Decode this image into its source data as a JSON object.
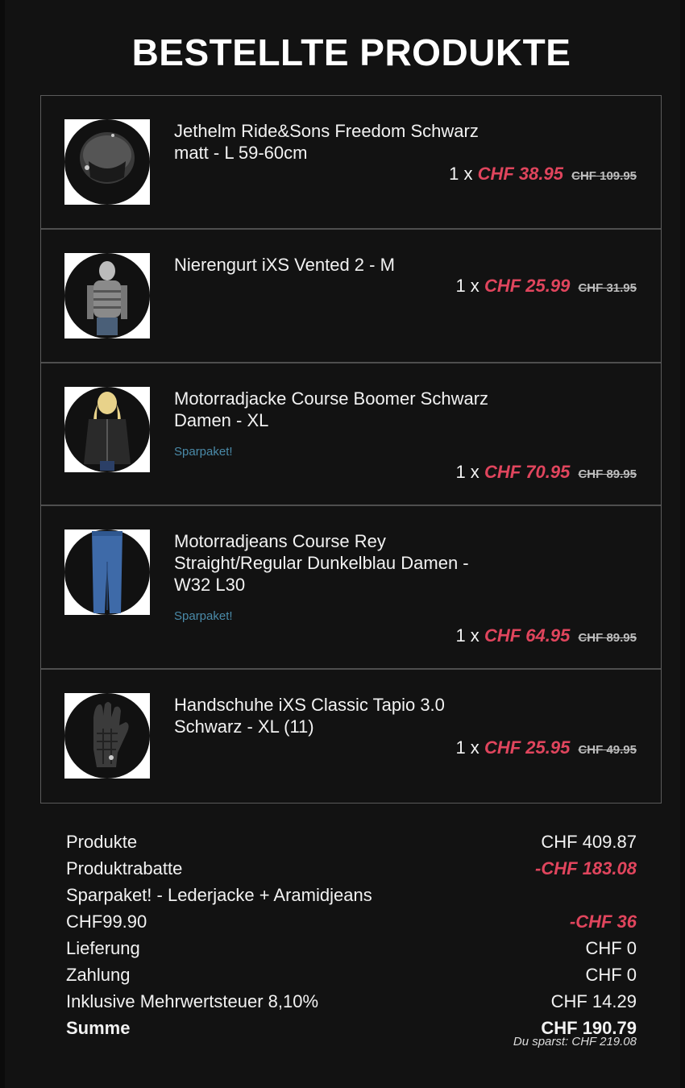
{
  "title": "BESTELLTE PRODUKTE",
  "products": [
    {
      "name": "Jethelm Ride&Sons Freedom Schwarz matt - L 59-60cm",
      "icon": "helmet-icon",
      "qty": "1 x",
      "price": "CHF 38.95",
      "old_price": "CHF 109.95",
      "badge": ""
    },
    {
      "name": "Nierengurt iXS Vented 2 - M",
      "icon": "kidney-belt-icon",
      "qty": "1 x",
      "price": "CHF 25.99",
      "old_price": "CHF 31.95",
      "badge": ""
    },
    {
      "name": "Motorradjacke Course Boomer Schwarz Damen - XL",
      "icon": "leather-jacket-icon",
      "qty": "1 x",
      "price": "CHF 70.95",
      "old_price": "CHF 89.95",
      "badge": "Sparpaket!"
    },
    {
      "name": "Motorradjeans Course Rey Straight/Regular Dunkelblau Damen - W32 L30",
      "icon": "jeans-icon",
      "qty": "1 x",
      "price": "CHF 64.95",
      "old_price": "CHF 89.95",
      "badge": "Sparpaket!"
    },
    {
      "name": "Handschuhe iXS Classic Tapio 3.0 Schwarz - XL (11)",
      "icon": "glove-icon",
      "qty": "1 x",
      "price": "CHF 25.95",
      "old_price": "CHF 49.95",
      "badge": ""
    }
  ],
  "summary": {
    "products_label": "Produkte",
    "products_value": "CHF 409.87",
    "discount_label": "Produktrabatte",
    "discount_value": "-CHF 183.08",
    "bundle_label": "Sparpaket! - Lederjacke + Aramidjeans CHF99.90",
    "bundle_value": "-CHF 36",
    "shipping_label": "Lieferung",
    "shipping_value": "CHF 0",
    "payment_label": "Zahlung",
    "payment_value": "CHF 0",
    "vat_label": "Inklusive Mehrwertsteuer 8,10%",
    "vat_value": "CHF 14.29",
    "total_label": "Summe",
    "total_value": "CHF 190.79",
    "saving_text": "Du sparst: CHF 219.08"
  },
  "colors": {
    "background": "#121212",
    "accent_price": "#e0455d",
    "badge": "#4a8aa8"
  }
}
